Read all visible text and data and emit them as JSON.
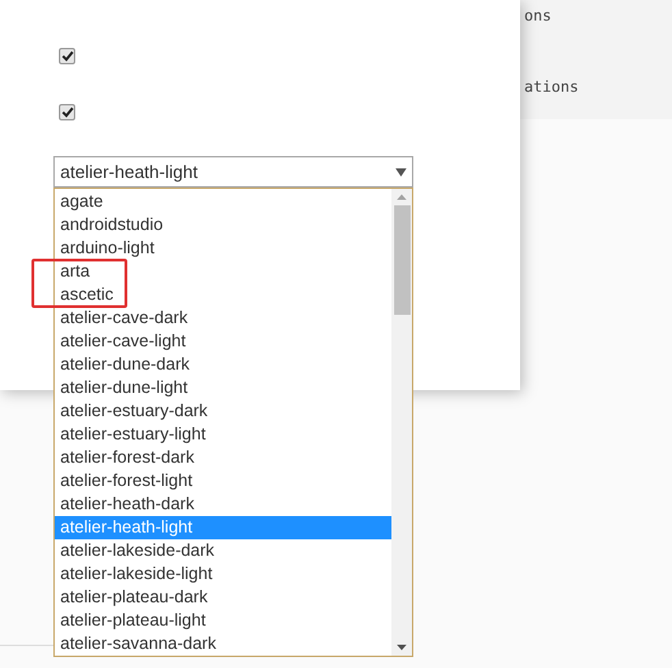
{
  "background_panel": {
    "lines": [
      "ons",
      "ations"
    ]
  },
  "checkboxes": [
    {
      "checked": true
    },
    {
      "checked": true
    }
  ],
  "theme_select": {
    "value": "atelier-heath-light",
    "expanded": true,
    "options": [
      {
        "label": "agate",
        "selected": false,
        "marked": false
      },
      {
        "label": "androidstudio",
        "selected": false,
        "marked": false
      },
      {
        "label": "arduino-light",
        "selected": false,
        "marked": false
      },
      {
        "label": "arta",
        "selected": false,
        "marked": true
      },
      {
        "label": "ascetic",
        "selected": false,
        "marked": true
      },
      {
        "label": "atelier-cave-dark",
        "selected": false,
        "marked": false
      },
      {
        "label": "atelier-cave-light",
        "selected": false,
        "marked": false
      },
      {
        "label": "atelier-dune-dark",
        "selected": false,
        "marked": false
      },
      {
        "label": "atelier-dune-light",
        "selected": false,
        "marked": false
      },
      {
        "label": "atelier-estuary-dark",
        "selected": false,
        "marked": false
      },
      {
        "label": "atelier-estuary-light",
        "selected": false,
        "marked": false
      },
      {
        "label": "atelier-forest-dark",
        "selected": false,
        "marked": false
      },
      {
        "label": "atelier-forest-light",
        "selected": false,
        "marked": false
      },
      {
        "label": "atelier-heath-dark",
        "selected": false,
        "marked": false
      },
      {
        "label": "atelier-heath-light",
        "selected": true,
        "marked": false
      },
      {
        "label": "atelier-lakeside-dark",
        "selected": false,
        "marked": false
      },
      {
        "label": "atelier-lakeside-light",
        "selected": false,
        "marked": false
      },
      {
        "label": "atelier-plateau-dark",
        "selected": false,
        "marked": false
      },
      {
        "label": "atelier-plateau-light",
        "selected": false,
        "marked": false
      },
      {
        "label": "atelier-savanna-dark",
        "selected": false,
        "marked": false
      }
    ]
  }
}
